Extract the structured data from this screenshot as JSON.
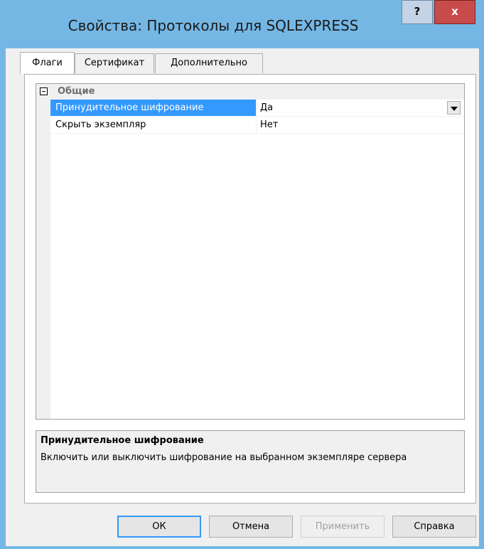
{
  "window": {
    "title": "Свойства: Протоколы для SQLEXPRESS",
    "help_label": "?",
    "close_label": "x"
  },
  "tabs": [
    {
      "label": "Флаги",
      "active": true
    },
    {
      "label": "Сертификат",
      "active": false
    },
    {
      "label": "Дополнительно",
      "active": false
    }
  ],
  "grid": {
    "category": "Общие",
    "rows": [
      {
        "name": "Принудительное шифрование",
        "value": "Да",
        "selected": true
      },
      {
        "name": "Скрыть экземпляр",
        "value": "Нет",
        "selected": false
      }
    ]
  },
  "description": {
    "title": "Принудительное шифрование",
    "text": "Включить или выключить шифрование на выбранном экземпляре сервера"
  },
  "buttons": {
    "ok": "ОК",
    "cancel": "Отмена",
    "apply": "Применить",
    "help": "Справка"
  }
}
